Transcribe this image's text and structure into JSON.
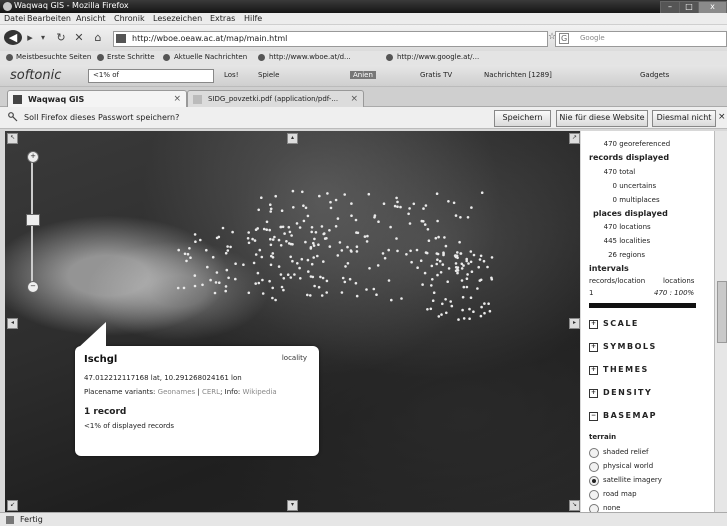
{
  "window": {
    "title": "Waqwaq GIS - Mozilla Firefox"
  },
  "menu": [
    "Datei",
    "Bearbeiten",
    "Ansicht",
    "Chronik",
    "Lesezeichen",
    "Extras",
    "Hilfe"
  ],
  "nav": {
    "url": "http://wboe.oeaw.ac.at/map/main.html",
    "search_placeholder": "Google",
    "search_engine": "G"
  },
  "bookmarks": [
    "Meistbesuchte Seiten",
    "Erste Schritte",
    "Aktuelle Nachrichten",
    "http://www.wboe.at/d...",
    "http://www.google.at/..."
  ],
  "softonic": {
    "brand": "softonic",
    "query": "<1% of",
    "items": [
      "Los!",
      "Spiele",
      "Anien",
      "Gratis TV",
      "Nachrichten [1289]",
      "Gadgets"
    ]
  },
  "tabs": [
    {
      "label": "Waqwaq GIS",
      "close": "×"
    },
    {
      "label": "SIDG_povzetki.pdf (application/pdf-...",
      "close": "×"
    }
  ],
  "password_bar": {
    "message": "Soll Firefox dieses Passwort speichern?",
    "save": "Speichern",
    "never": "Nie für diese Website",
    "not_now": "Diesmal nicht",
    "close": "×"
  },
  "map": {
    "zoom_in": "+",
    "zoom_out": "−",
    "zoom_level_fraction": 0.55
  },
  "popup": {
    "name": "Ischgl",
    "type": "locality",
    "coords": "47.012212117168 lat, 10.291268024161 lon",
    "variants_label": "Placename variants:",
    "variants_links": [
      "Geonames",
      "CERL"
    ],
    "info_label": "Info:",
    "info_link": "Wikipedia",
    "count": "1 record",
    "share": "<1% of displayed records"
  },
  "panel": {
    "georef": {
      "value": "470",
      "label": "georeferenced"
    },
    "records_title": "records displayed",
    "records": [
      {
        "value": "470",
        "label": "total"
      },
      {
        "value": "0",
        "label": "uncertains"
      },
      {
        "value": "0",
        "label": "multiplaces"
      }
    ],
    "places_title": "places displayed",
    "places": [
      {
        "value": "470",
        "label": "locations"
      },
      {
        "value": "445",
        "label": "localities"
      },
      {
        "value": "26",
        "label": "regions"
      }
    ],
    "intervals_title": "intervals",
    "intervals_col1": "records/location",
    "intervals_col2": "locations",
    "interval_from": "1",
    "interval_to": "470 : 100%",
    "sections": [
      "SCALE",
      "SYMBOLS",
      "THEMES",
      "DENSITY",
      "BASEMAP"
    ],
    "basemap_title": "terrain",
    "basemaps": [
      {
        "label": "shaded relief",
        "selected": false
      },
      {
        "label": "physical world",
        "selected": false
      },
      {
        "label": "satellite imagery",
        "selected": true
      },
      {
        "label": "road map",
        "selected": false
      },
      {
        "label": "none",
        "selected": false
      }
    ]
  },
  "status": {
    "text": "Fertig"
  }
}
